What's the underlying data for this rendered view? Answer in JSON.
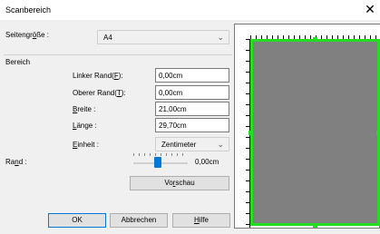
{
  "window": {
    "title": "Scanbereich",
    "close_glyph": "✕"
  },
  "paper_size": {
    "label_pre": "Seitengr",
    "label_ul": "ö",
    "label_post": "ße :",
    "value": "A4"
  },
  "area": {
    "group_label": "Bereich",
    "left_margin": {
      "label_pre": "Linker Rand(",
      "label_ul": "F",
      "label_post": "):",
      "value": "0,00cm"
    },
    "top_margin": {
      "label_pre": "Oberer Rand(",
      "label_ul": "T",
      "label_post": "):",
      "value": "0,00cm"
    },
    "width": {
      "label_pre": "",
      "label_ul": "B",
      "label_post": "reite :",
      "value": "21,00cm"
    },
    "length": {
      "label_pre": "",
      "label_ul": "L",
      "label_post": "änge :",
      "value": "29,70cm"
    },
    "unit": {
      "label_pre": "",
      "label_ul": "E",
      "label_post": "inheit :",
      "value": "Zentimeter"
    }
  },
  "margin": {
    "label_pre": "Ra",
    "label_ul": "n",
    "label_post": "d :",
    "value": "0,00cm",
    "slider_level": 0.45
  },
  "buttons": {
    "preview_pre": "Vo",
    "preview_ul": "r",
    "preview_post": "schau",
    "ok": "OK",
    "cancel": "Abbrechen",
    "help_pre": "",
    "help_ul": "H",
    "help_post": "ilfe"
  },
  "icons": {
    "dropdown": "chevron-down-icon",
    "close": "close-icon"
  },
  "colors": {
    "selection": "#22dd22",
    "scan_area": "#808080",
    "accent": "#0078d7"
  }
}
